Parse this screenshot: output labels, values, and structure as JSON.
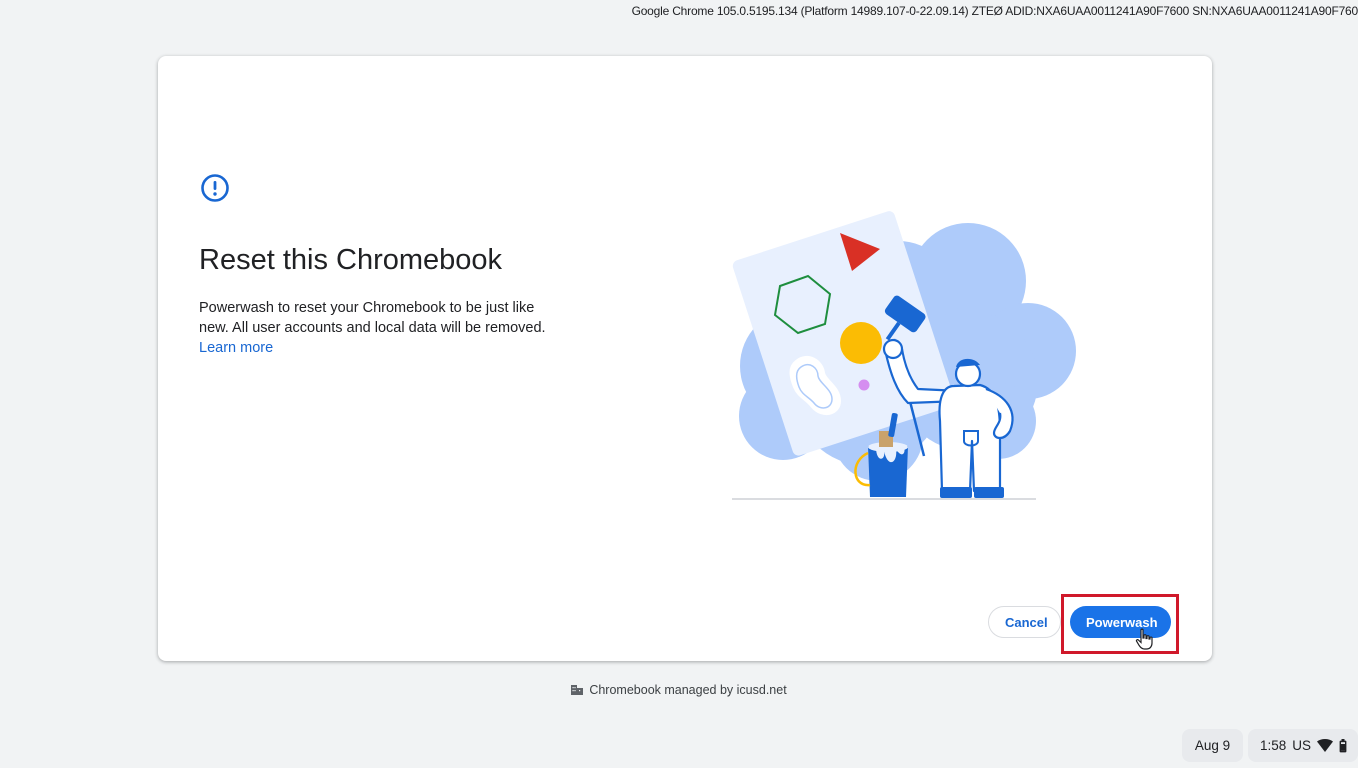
{
  "system": {
    "version_info": "Google Chrome 105.0.5195.134 (Platform 14989.107-0-22.09.14) ZTEØ ADID:NXA6UAA0011241A90F7600 SN:NXA6UAA0011241A90F760"
  },
  "dialog": {
    "title": "Reset this Chromebook",
    "description": "Powerwash to reset your Chromebook to be just like new. All user accounts and local data will be removed.",
    "learn_more": "Learn more",
    "cancel_label": "Cancel",
    "powerwash_label": "Powerwash"
  },
  "footer": {
    "managed_text": "Chromebook managed by icusd.net"
  },
  "shelf": {
    "date": "Aug 9",
    "time": "1:58",
    "input_method": "US"
  },
  "colors": {
    "accent": "#1a73e8",
    "highlight": "#d0182a"
  }
}
